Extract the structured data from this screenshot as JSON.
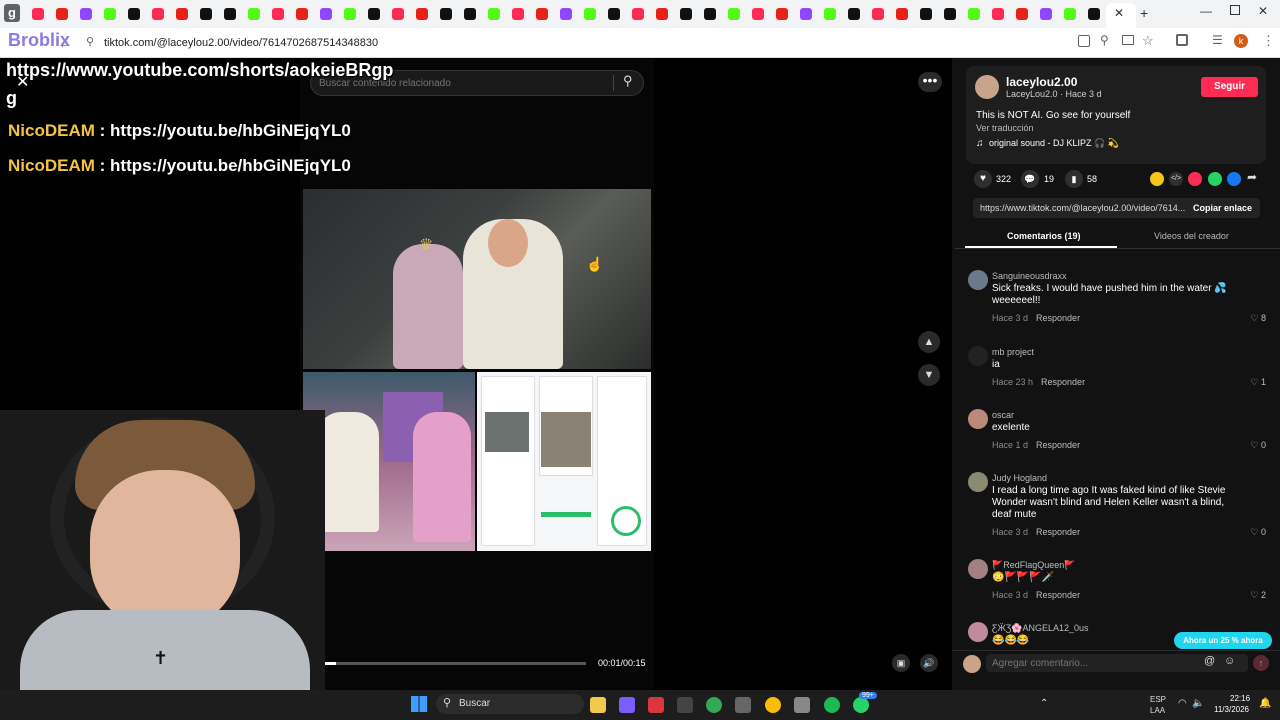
{
  "browser": {
    "url": "tiktok.com/@laceylou2.00/video/7614702687514348830",
    "brand_text": "Broblix"
  },
  "overlay": {
    "youtube_url": "https://www.youtube.com/shorts/aokeieBRgp",
    "youtube_url_tail": "g",
    "chat": [
      {
        "user": "NicoDEAM",
        "sep": ":",
        "msg": "https://youtu.be/hbGiNEjqYL0"
      },
      {
        "user": "NicoDEAM",
        "sep": ":",
        "msg": "https://youtu.be/hbGiNEjqYL0"
      }
    ]
  },
  "video": {
    "search_placeholder": "Buscar contenido relacionado",
    "time": "00:01/00:15",
    "progress_fraction": 0.067
  },
  "panel": {
    "username": "laceylou2.00",
    "subline": "LaceyLou2.0 · Hace 3 d",
    "follow_label": "Seguir",
    "description": "This is NOT AI. Go see for yourself",
    "translate_label": "Ver traducción",
    "sound": "original sound - DJ KLIPZ 🎧 💫",
    "likes": "322",
    "comments_count": "19",
    "saves": "58",
    "share_url": "https://www.tiktok.com/@laceylou2.00/video/7614...",
    "copy_label": "Copiar enlace",
    "tab_comments": "Comentarios (19)",
    "tab_creator": "Videos del creador",
    "comments": [
      {
        "user": "Sanguineousdraxx",
        "text": "Sick freaks. I would have pushed him in the water 💦 weeeeeel!!",
        "time": "Hace 3 d",
        "reply": "Responder",
        "likes": "8",
        "avatar": "#6b7a8a"
      },
      {
        "user": "mb project",
        "text": "ia",
        "time": "Hace 23 h",
        "reply": "Responder",
        "likes": "1",
        "avatar": "#222222"
      },
      {
        "user": "oscar",
        "text": "exelente",
        "time": "Hace 1 d",
        "reply": "Responder",
        "likes": "0",
        "avatar": "#b98a7a"
      },
      {
        "user": "Judy Hogland",
        "text": "I read a long time ago It was faked kind of like Stevie Wonder wasn't blind and Helen Keller wasn't a blind, deaf mute",
        "time": "Hace 3 d",
        "reply": "Responder",
        "likes": "0",
        "avatar": "#8a8a70"
      },
      {
        "user": "🚩RedFlagQueen🚩",
        "text": "😳🚩🚩🚩🗡️",
        "time": "Hace 3 d",
        "reply": "Responder",
        "likes": "2",
        "avatar": "#a08080"
      },
      {
        "user": "ƸӜƷ🌸ANGELA12_0us",
        "text": "😂😂😂",
        "time": "",
        "reply": "",
        "likes": "",
        "avatar": "#c08a9a"
      }
    ],
    "promo": "Ahora un 25 % ahora",
    "comment_placeholder": "Agregar comentario..."
  },
  "taskbar": {
    "search": "Buscar",
    "lang": "ESP",
    "lang2": "LAA",
    "clock_time": "22:16",
    "clock_date": "11/3/2026",
    "badge": "99+"
  },
  "colors": {
    "accent": "#fe2c55",
    "overlay_user": "#f5c542",
    "promo": "#20d5ec"
  }
}
